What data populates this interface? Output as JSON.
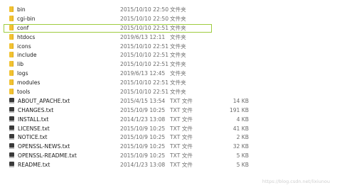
{
  "files": [
    {
      "name": "bin",
      "date": "2015/10/10 22:50",
      "type": "文件夹",
      "size": "",
      "kind": "folder",
      "icon": "folder-icon"
    },
    {
      "name": "cgi-bin",
      "date": "2015/10/10 22:50",
      "type": "文件夹",
      "size": "",
      "kind": "folder",
      "icon": "folder-icon"
    },
    {
      "name": "conf",
      "date": "2015/10/10 22:51",
      "type": "文件夹",
      "size": "",
      "kind": "folder",
      "icon": "folder-icon",
      "selected": true
    },
    {
      "name": "htdocs",
      "date": "2019/6/13 12:11",
      "type": "文件夹",
      "size": "",
      "kind": "folder",
      "icon": "folder-icon"
    },
    {
      "name": "icons",
      "date": "2015/10/10 22:51",
      "type": "文件夹",
      "size": "",
      "kind": "folder",
      "icon": "folder-icon"
    },
    {
      "name": "include",
      "date": "2015/10/10 22:51",
      "type": "文件夹",
      "size": "",
      "kind": "folder",
      "icon": "folder-icon"
    },
    {
      "name": "lib",
      "date": "2015/10/10 22:51",
      "type": "文件夹",
      "size": "",
      "kind": "folder",
      "icon": "folder-icon"
    },
    {
      "name": "logs",
      "date": "2019/6/13 12:45",
      "type": "文件夹",
      "size": "",
      "kind": "folder",
      "icon": "folder-icon"
    },
    {
      "name": "modules",
      "date": "2015/10/10 22:51",
      "type": "文件夹",
      "size": "",
      "kind": "folder",
      "icon": "folder-icon"
    },
    {
      "name": "tools",
      "date": "2015/10/10 22:51",
      "type": "文件夹",
      "size": "",
      "kind": "folder",
      "icon": "folder-icon"
    },
    {
      "name": "ABOUT_APACHE.txt",
      "date": "2015/4/15 13:54",
      "type": "TXT 文件",
      "size": "14 KB",
      "kind": "file",
      "icon": "text-file-icon"
    },
    {
      "name": "CHANGES.txt",
      "date": "2015/10/9 10:25",
      "type": "TXT 文件",
      "size": "191 KB",
      "kind": "file",
      "icon": "text-file-icon"
    },
    {
      "name": "INSTALL.txt",
      "date": "2014/1/23 13:08",
      "type": "TXT 文件",
      "size": "4 KB",
      "kind": "file",
      "icon": "text-file-icon"
    },
    {
      "name": "LICENSE.txt",
      "date": "2015/10/9 10:25",
      "type": "TXT 文件",
      "size": "41 KB",
      "kind": "file",
      "icon": "text-file-icon"
    },
    {
      "name": "NOTICE.txt",
      "date": "2015/10/9 10:25",
      "type": "TXT 文件",
      "size": "2 KB",
      "kind": "file",
      "icon": "text-file-icon"
    },
    {
      "name": "OPENSSL-NEWS.txt",
      "date": "2015/10/9 10:25",
      "type": "TXT 文件",
      "size": "32 KB",
      "kind": "file",
      "icon": "text-file-icon"
    },
    {
      "name": "OPENSSL-README.txt",
      "date": "2015/10/9 10:25",
      "type": "TXT 文件",
      "size": "5 KB",
      "kind": "file",
      "icon": "text-file-icon"
    },
    {
      "name": "README.txt",
      "date": "2014/1/23 13:08",
      "type": "TXT 文件",
      "size": "5 KB",
      "kind": "file",
      "icon": "text-file-icon"
    }
  ],
  "watermark": "https://blog.csdn.net/lixiunou",
  "colors": {
    "selection_border": "#9ecc3f",
    "folder": "#f1c232",
    "secondary_text": "#6b6b6b"
  }
}
